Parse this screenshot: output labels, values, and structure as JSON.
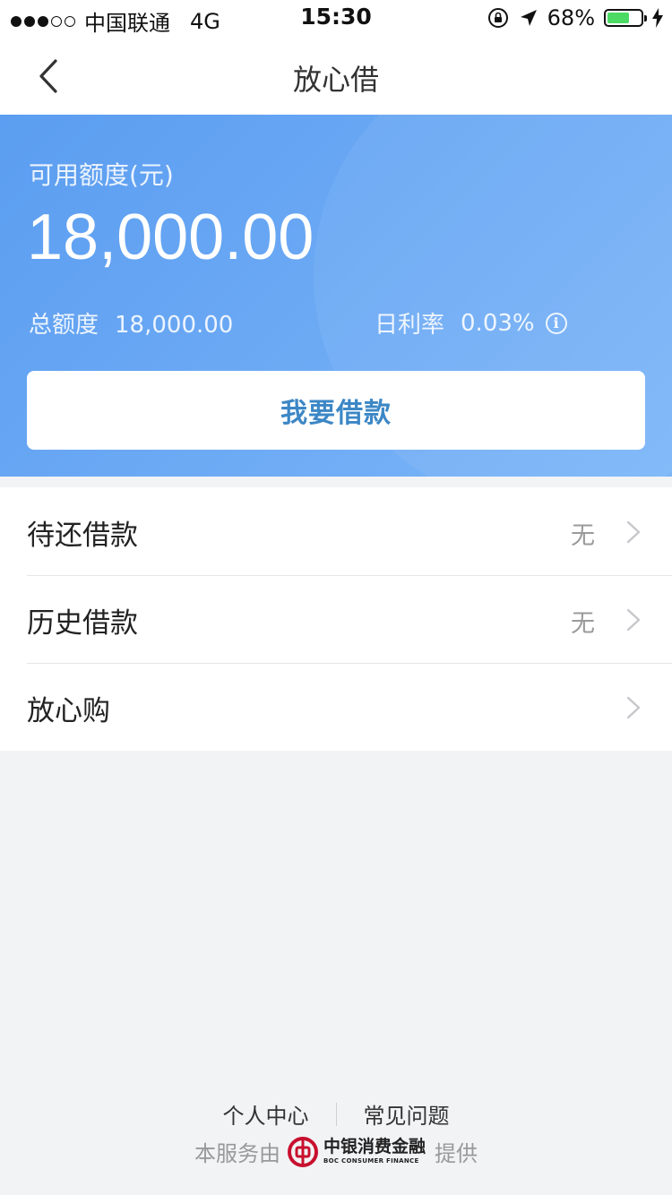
{
  "status_bar": {
    "carrier": "中国联通",
    "network": "4G",
    "time": "15:30",
    "battery": "68%",
    "battery_level": 0.68,
    "signal_bars_filled": 3,
    "signal_bars_total": 5
  },
  "nav": {
    "title": "放心借",
    "back_icon": "chevron-left-icon"
  },
  "hero": {
    "available_label": "可用额度(元)",
    "available_amount": "18,000.00",
    "total_label": "总额度",
    "total_value": "18,000.00",
    "rate_label": "日利率",
    "rate_value": "0.03%",
    "info_icon": "info-icon",
    "info_glyph": "i",
    "borrow_button": "我要借款"
  },
  "list": {
    "items": [
      {
        "label": "待还借款",
        "value": "无"
      },
      {
        "label": "历史借款",
        "value": "无"
      },
      {
        "label": "放心购",
        "value": ""
      }
    ]
  },
  "footer": {
    "personal_center": "个人中心",
    "faq": "常见问题",
    "provider_prefix": "本服务由",
    "provider_name_cn": "中银消费金融",
    "provider_name_en": "BOC CONSUMER FINANCE",
    "provider_suffix": "提供"
  },
  "colors": {
    "hero_gradient_start": "#5b9df0",
    "hero_gradient_end": "#7cb6f8",
    "button_text": "#3c87c6",
    "battery_green": "#4cd964",
    "boc_red": "#c8102e"
  }
}
